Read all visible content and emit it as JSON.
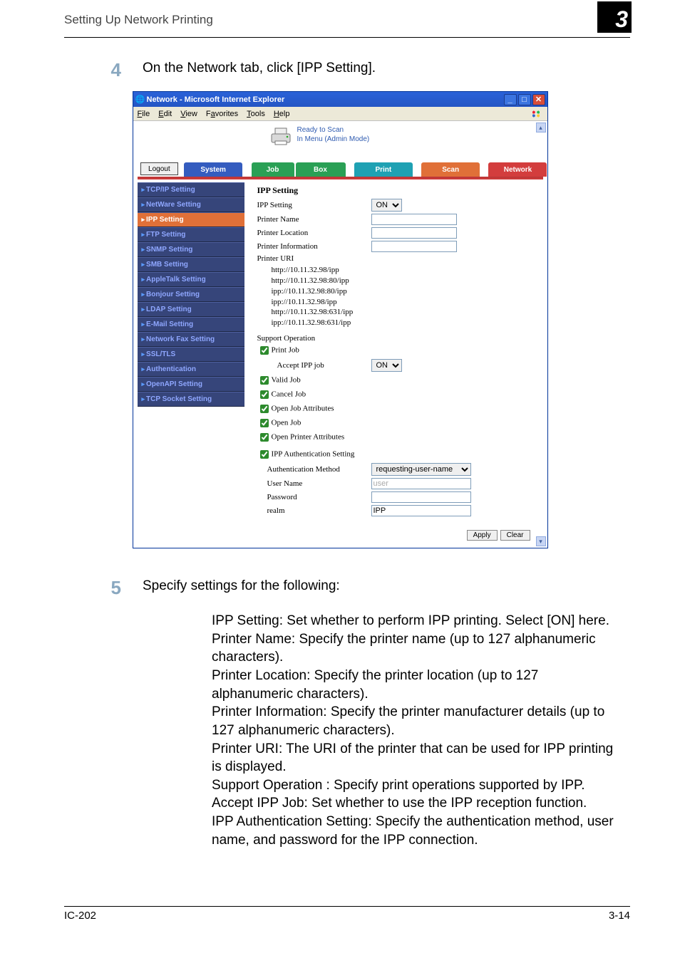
{
  "running_head": "Setting Up Network Printing",
  "step4": {
    "num": "4",
    "text": "On the Network tab, click [IPP Setting]."
  },
  "step5": {
    "num": "5",
    "intro": "Specify settings for the following:",
    "body": "IPP Setting: Set whether to perform IPP printing. Select [ON] here.\nPrinter Name: Specify the printer name (up to 127 alphanumeric characters).\nPrinter Location: Specify the printer location (up to 127 alphanumeric characters).\nPrinter Information: Specify the printer manufacturer details (up to 127 alphanumeric characters).\nPrinter URI: The URI of the printer that can be used for IPP printing is displayed.\nSupport Operation : Specify print operations supported by IPP.\nAccept IPP Job: Set whether to use the IPP reception function.\nIPP Authentication Setting: Specify the authentication method, user name, and password for the IPP connection."
  },
  "ie": {
    "title": "Network - Microsoft Internet Explorer",
    "menu": {
      "file": "File",
      "edit": "Edit",
      "view": "View",
      "fav": "Favorites",
      "tools": "Tools",
      "help": "Help"
    },
    "status_line1": "Ready to Scan",
    "status_line2": "In Menu (Admin Mode)",
    "logout": "Logout",
    "tabs": {
      "system": "System",
      "job": "Job",
      "box": "Box",
      "print": "Print",
      "scan": "Scan",
      "network": "Network"
    }
  },
  "sidebar": [
    "TCP/IP Setting",
    "NetWare Setting",
    "IPP Setting",
    "FTP Setting",
    "SNMP Setting",
    "SMB Setting",
    "AppleTalk Setting",
    "Bonjour Setting",
    "LDAP Setting",
    "E-Mail Setting",
    "Network Fax Setting",
    "SSL/TLS",
    "Authentication",
    "OpenAPI Setting",
    "TCP Socket Setting"
  ],
  "sidebar_active_index": 2,
  "form": {
    "heading": "IPP Setting",
    "labels": {
      "ipp_setting": "IPP Setting",
      "printer_name": "Printer Name",
      "printer_location": "Printer Location",
      "printer_info": "Printer Information",
      "printer_uri": "Printer URI",
      "support_operation": "Support Operation",
      "print_job": "Print Job",
      "accept_ipp_job": "Accept IPP job",
      "valid_job": "Valid Job",
      "cancel_job": "Cancel Job",
      "open_job_attr": "Open Job Attributes",
      "open_job": "Open Job",
      "open_printer_attr": "Open Printer Attributes",
      "ipp_auth_setting": "IPP Authentication Setting",
      "auth_method": "Authentication Method",
      "user_name": "User Name",
      "password": "Password",
      "realm": "realm"
    },
    "values": {
      "ipp_setting_select": "ON",
      "accept_select": "ON",
      "auth_method_select": "requesting-user-name",
      "user_name": "user",
      "password": "",
      "realm": "IPP"
    },
    "uris": [
      "http://10.11.32.98/ipp",
      "http://10.11.32.98:80/ipp",
      "ipp://10.11.32.98:80/ipp",
      "ipp://10.11.32.98/ipp",
      "http://10.11.32.98:631/ipp",
      "ipp://10.11.32.98:631/ipp"
    ],
    "buttons": {
      "apply": "Apply",
      "clear": "Clear"
    }
  },
  "footer": {
    "left": "IC-202",
    "right": "3-14"
  }
}
